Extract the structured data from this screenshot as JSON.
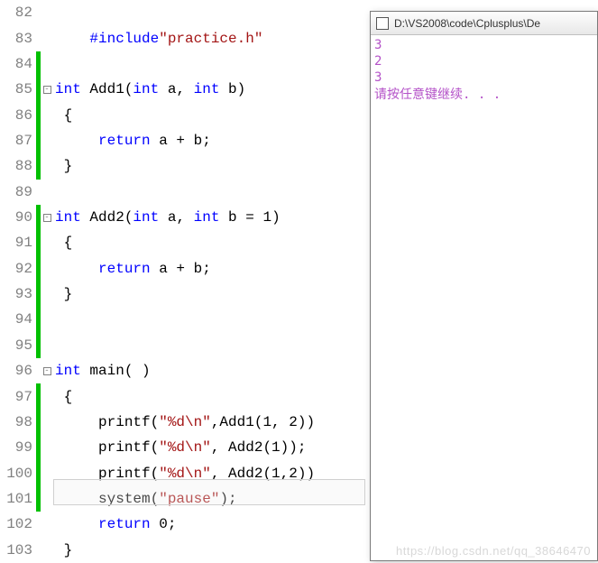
{
  "editor": {
    "highlightLine": 100,
    "lines": [
      {
        "num": 82,
        "bar": "none",
        "fold": "",
        "tokens": []
      },
      {
        "num": 83,
        "bar": "none",
        "fold": "",
        "tokens": [
          {
            "t": "    ",
            "c": ""
          },
          {
            "t": "#include",
            "c": "pp"
          },
          {
            "t": "\"practice.h\"",
            "c": "inc"
          }
        ]
      },
      {
        "num": 84,
        "bar": "green",
        "fold": "",
        "tokens": []
      },
      {
        "num": 85,
        "bar": "green",
        "fold": "minus",
        "tokens": [
          {
            "t": "int",
            "c": "kw"
          },
          {
            "t": " Add1(",
            "c": ""
          },
          {
            "t": "int",
            "c": "kw"
          },
          {
            "t": " a, ",
            "c": ""
          },
          {
            "t": "int",
            "c": "kw"
          },
          {
            "t": " b)",
            "c": ""
          }
        ]
      },
      {
        "num": 86,
        "bar": "green",
        "fold": "",
        "tokens": [
          {
            "t": " {",
            "c": ""
          }
        ]
      },
      {
        "num": 87,
        "bar": "green",
        "fold": "",
        "tokens": [
          {
            "t": "     ",
            "c": ""
          },
          {
            "t": "return",
            "c": "kw"
          },
          {
            "t": " a + b;",
            "c": ""
          }
        ]
      },
      {
        "num": 88,
        "bar": "green",
        "fold": "",
        "tokens": [
          {
            "t": " }",
            "c": ""
          }
        ]
      },
      {
        "num": 89,
        "bar": "none",
        "fold": "",
        "tokens": []
      },
      {
        "num": 90,
        "bar": "green",
        "fold": "minus",
        "tokens": [
          {
            "t": "int",
            "c": "kw"
          },
          {
            "t": " Add2(",
            "c": ""
          },
          {
            "t": "int",
            "c": "kw"
          },
          {
            "t": " a, ",
            "c": ""
          },
          {
            "t": "int",
            "c": "kw"
          },
          {
            "t": " b = 1)",
            "c": ""
          }
        ]
      },
      {
        "num": 91,
        "bar": "green",
        "fold": "",
        "tokens": [
          {
            "t": " {",
            "c": ""
          }
        ]
      },
      {
        "num": 92,
        "bar": "green",
        "fold": "",
        "tokens": [
          {
            "t": "     ",
            "c": ""
          },
          {
            "t": "return",
            "c": "kw"
          },
          {
            "t": " a + b;",
            "c": ""
          }
        ]
      },
      {
        "num": 93,
        "bar": "green",
        "fold": "",
        "tokens": [
          {
            "t": " }",
            "c": ""
          }
        ]
      },
      {
        "num": 94,
        "bar": "green",
        "fold": "",
        "tokens": []
      },
      {
        "num": 95,
        "bar": "green",
        "fold": "",
        "tokens": []
      },
      {
        "num": 96,
        "bar": "none",
        "fold": "minus",
        "tokens": [
          {
            "t": "int",
            "c": "kw"
          },
          {
            "t": " main( )",
            "c": ""
          }
        ]
      },
      {
        "num": 97,
        "bar": "green",
        "fold": "",
        "tokens": [
          {
            "t": " {",
            "c": ""
          }
        ]
      },
      {
        "num": 98,
        "bar": "green",
        "fold": "",
        "tokens": [
          {
            "t": "     printf(",
            "c": ""
          },
          {
            "t": "\"%d\\n\"",
            "c": "str"
          },
          {
            "t": ",Add1(1, 2))",
            "c": ""
          }
        ]
      },
      {
        "num": 99,
        "bar": "green",
        "fold": "",
        "tokens": [
          {
            "t": "     printf(",
            "c": ""
          },
          {
            "t": "\"%d\\n\"",
            "c": "str"
          },
          {
            "t": ", Add2(1));",
            "c": ""
          }
        ]
      },
      {
        "num": 100,
        "bar": "green",
        "fold": "",
        "tokens": [
          {
            "t": "     printf(",
            "c": ""
          },
          {
            "t": "\"%d\\n\"",
            "c": "str"
          },
          {
            "t": ", Add2(1,2))",
            "c": ""
          }
        ]
      },
      {
        "num": 101,
        "bar": "green",
        "fold": "",
        "tokens": [
          {
            "t": "     system(",
            "c": ""
          },
          {
            "t": "\"pause\"",
            "c": "str"
          },
          {
            "t": ");",
            "c": ""
          }
        ]
      },
      {
        "num": 102,
        "bar": "none",
        "fold": "",
        "tokens": [
          {
            "t": "     ",
            "c": ""
          },
          {
            "t": "return",
            "c": "kw"
          },
          {
            "t": " 0;",
            "c": ""
          }
        ]
      },
      {
        "num": 103,
        "bar": "none",
        "fold": "",
        "tokens": [
          {
            "t": " }",
            "c": ""
          }
        ]
      }
    ]
  },
  "console": {
    "title": "D:\\VS2008\\code\\Cplusplus\\De",
    "output": "3\n2\n3\n请按任意键继续. . ."
  },
  "watermark": "https://blog.csdn.net/qq_38646470"
}
